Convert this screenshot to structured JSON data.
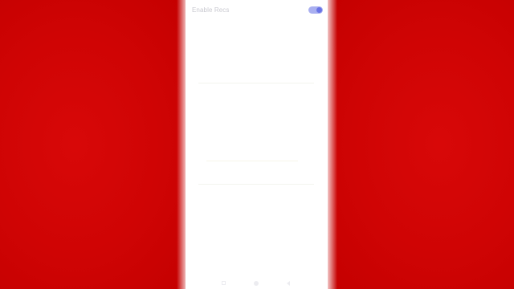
{
  "settings": {
    "enable_label": "Enable Recs",
    "enable_toggle": {
      "on": true
    }
  },
  "colors": {
    "background": "#cf0404",
    "toggle_track": "#a9aff0",
    "toggle_knob": "#6a74e6"
  },
  "nav_bar": {
    "icons": [
      "recents-icon",
      "home-icon",
      "back-icon"
    ]
  }
}
